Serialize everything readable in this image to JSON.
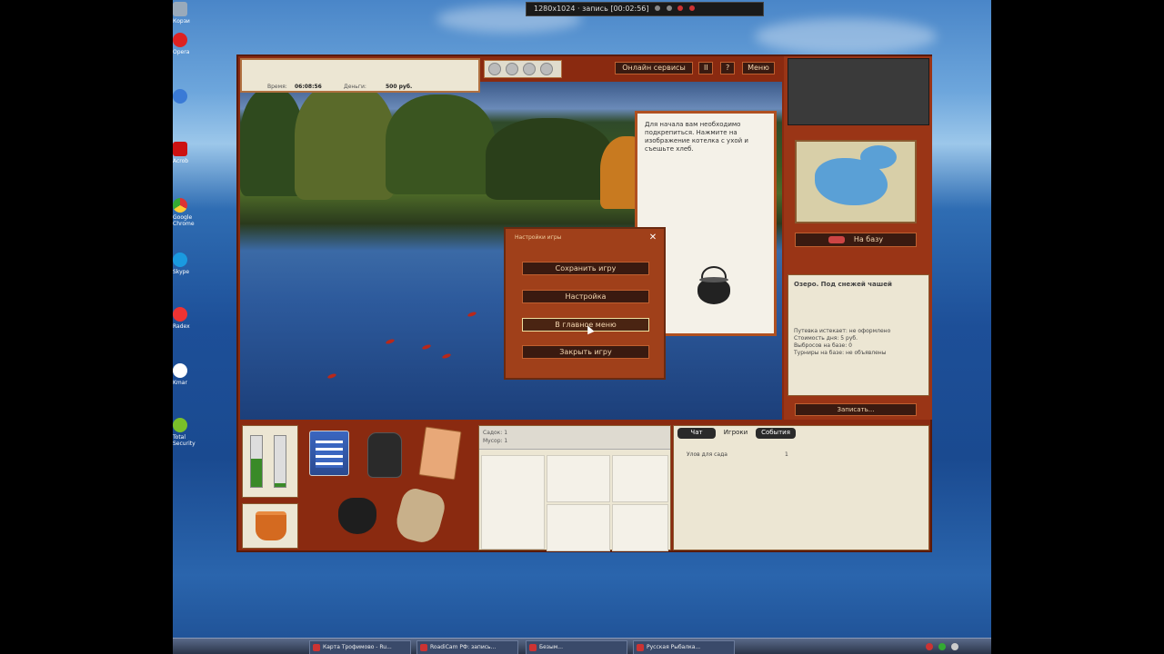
{
  "recorder": {
    "text": "1280x1024 · запись [00:02:56]"
  },
  "desktop_icons": [
    {
      "label": "Корзи"
    },
    {
      "label": "Opera"
    },
    {
      "label": ""
    },
    {
      "label": "Acrob"
    },
    {
      "label": "Google Chrome"
    },
    {
      "label": "Skype"
    },
    {
      "label": "Radex"
    },
    {
      "label": "Kmar"
    },
    {
      "label": "Total Security"
    }
  ],
  "game": {
    "info": {
      "time_label": "Время:",
      "time_value": "06:08:56",
      "money_label": "Деньги:",
      "money_value": "500 руб."
    },
    "topbar": {
      "online_services": "Онлайн сервисы",
      "pause": "II",
      "help": "?",
      "menu": "Меню"
    },
    "hint": {
      "text": "Для начала вам необходимо подкрепиться. Нажмите на изображение котелка с ухой и съешьте хлеб."
    },
    "dialog": {
      "title": "Настройки игры",
      "close": "✕",
      "save": "Сохранить игру",
      "settings": "Настройка",
      "main_menu": "В главное меню",
      "close_game": "Закрыть игру"
    },
    "right": {
      "base_button": "На базу",
      "lake_title": "Озеро. Под снежей чашей",
      "lake_lines": [
        "Путевка истекает: не оформлено",
        "Стоимость дня: 5 руб.",
        "Выбросов на базе: 0",
        "Турниры на базе: не объявлены"
      ],
      "write_button": "Записать..."
    },
    "grid": {
      "head_line1": "Садок: 1",
      "head_line2": "Мусор: 1"
    },
    "chat": {
      "tabs": [
        "Чат",
        "Игроки",
        "События"
      ],
      "row_name": "Улов для сада",
      "row_value": "1"
    }
  },
  "taskbar": {
    "items": [
      "Карта Трофимово - Ru...",
      "RoadiCam РФ: запись...",
      "Безым...",
      "Русская Рыбалка..."
    ]
  }
}
